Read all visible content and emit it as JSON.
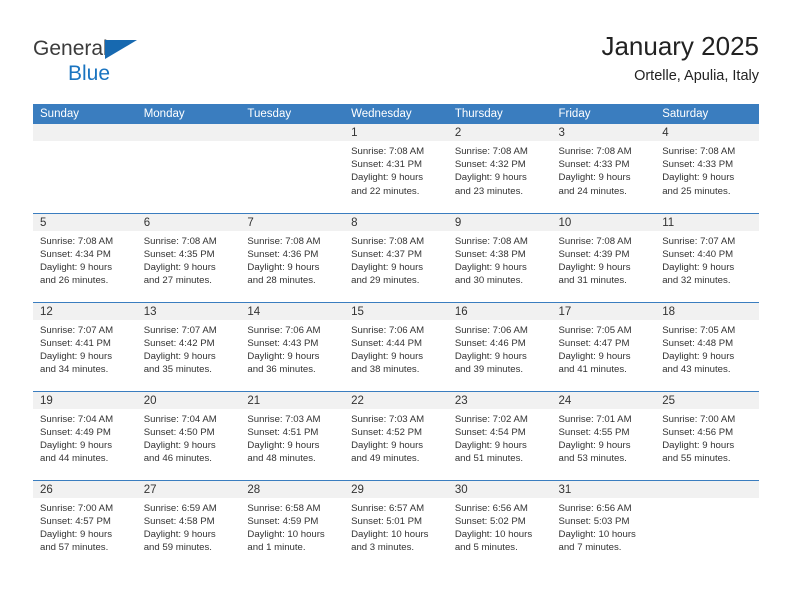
{
  "brand": {
    "line1": "General",
    "line2": "Blue",
    "triangle_icon": "blue-triangle-icon",
    "accent_color": "#1769b0"
  },
  "header": {
    "title": "January 2025",
    "subtitle": "Ortelle, Apulia, Italy"
  },
  "theme": {
    "header_blue": "#3a7dbf",
    "daynum_band": "#f1f1f1",
    "text": "#333333"
  },
  "calendar": {
    "weekday_headers": [
      "Sunday",
      "Monday",
      "Tuesday",
      "Wednesday",
      "Thursday",
      "Friday",
      "Saturday"
    ],
    "labels": {
      "sunrise": "Sunrise:",
      "sunset": "Sunset:",
      "daylight": "Daylight:"
    },
    "weeks": [
      [
        {
          "day": "",
          "empty": true
        },
        {
          "day": "",
          "empty": true
        },
        {
          "day": "",
          "empty": true
        },
        {
          "day": "1",
          "sunrise": "Sunrise: 7:08 AM",
          "sunset": "Sunset: 4:31 PM",
          "daylight_1": "Daylight: 9 hours",
          "daylight_2": "and 22 minutes."
        },
        {
          "day": "2",
          "sunrise": "Sunrise: 7:08 AM",
          "sunset": "Sunset: 4:32 PM",
          "daylight_1": "Daylight: 9 hours",
          "daylight_2": "and 23 minutes."
        },
        {
          "day": "3",
          "sunrise": "Sunrise: 7:08 AM",
          "sunset": "Sunset: 4:33 PM",
          "daylight_1": "Daylight: 9 hours",
          "daylight_2": "and 24 minutes."
        },
        {
          "day": "4",
          "sunrise": "Sunrise: 7:08 AM",
          "sunset": "Sunset: 4:33 PM",
          "daylight_1": "Daylight: 9 hours",
          "daylight_2": "and 25 minutes."
        }
      ],
      [
        {
          "day": "5",
          "sunrise": "Sunrise: 7:08 AM",
          "sunset": "Sunset: 4:34 PM",
          "daylight_1": "Daylight: 9 hours",
          "daylight_2": "and 26 minutes."
        },
        {
          "day": "6",
          "sunrise": "Sunrise: 7:08 AM",
          "sunset": "Sunset: 4:35 PM",
          "daylight_1": "Daylight: 9 hours",
          "daylight_2": "and 27 minutes."
        },
        {
          "day": "7",
          "sunrise": "Sunrise: 7:08 AM",
          "sunset": "Sunset: 4:36 PM",
          "daylight_1": "Daylight: 9 hours",
          "daylight_2": "and 28 minutes."
        },
        {
          "day": "8",
          "sunrise": "Sunrise: 7:08 AM",
          "sunset": "Sunset: 4:37 PM",
          "daylight_1": "Daylight: 9 hours",
          "daylight_2": "and 29 minutes."
        },
        {
          "day": "9",
          "sunrise": "Sunrise: 7:08 AM",
          "sunset": "Sunset: 4:38 PM",
          "daylight_1": "Daylight: 9 hours",
          "daylight_2": "and 30 minutes."
        },
        {
          "day": "10",
          "sunrise": "Sunrise: 7:08 AM",
          "sunset": "Sunset: 4:39 PM",
          "daylight_1": "Daylight: 9 hours",
          "daylight_2": "and 31 minutes."
        },
        {
          "day": "11",
          "sunrise": "Sunrise: 7:07 AM",
          "sunset": "Sunset: 4:40 PM",
          "daylight_1": "Daylight: 9 hours",
          "daylight_2": "and 32 minutes."
        }
      ],
      [
        {
          "day": "12",
          "sunrise": "Sunrise: 7:07 AM",
          "sunset": "Sunset: 4:41 PM",
          "daylight_1": "Daylight: 9 hours",
          "daylight_2": "and 34 minutes."
        },
        {
          "day": "13",
          "sunrise": "Sunrise: 7:07 AM",
          "sunset": "Sunset: 4:42 PM",
          "daylight_1": "Daylight: 9 hours",
          "daylight_2": "and 35 minutes."
        },
        {
          "day": "14",
          "sunrise": "Sunrise: 7:06 AM",
          "sunset": "Sunset: 4:43 PM",
          "daylight_1": "Daylight: 9 hours",
          "daylight_2": "and 36 minutes."
        },
        {
          "day": "15",
          "sunrise": "Sunrise: 7:06 AM",
          "sunset": "Sunset: 4:44 PM",
          "daylight_1": "Daylight: 9 hours",
          "daylight_2": "and 38 minutes."
        },
        {
          "day": "16",
          "sunrise": "Sunrise: 7:06 AM",
          "sunset": "Sunset: 4:46 PM",
          "daylight_1": "Daylight: 9 hours",
          "daylight_2": "and 39 minutes."
        },
        {
          "day": "17",
          "sunrise": "Sunrise: 7:05 AM",
          "sunset": "Sunset: 4:47 PM",
          "daylight_1": "Daylight: 9 hours",
          "daylight_2": "and 41 minutes."
        },
        {
          "day": "18",
          "sunrise": "Sunrise: 7:05 AM",
          "sunset": "Sunset: 4:48 PM",
          "daylight_1": "Daylight: 9 hours",
          "daylight_2": "and 43 minutes."
        }
      ],
      [
        {
          "day": "19",
          "sunrise": "Sunrise: 7:04 AM",
          "sunset": "Sunset: 4:49 PM",
          "daylight_1": "Daylight: 9 hours",
          "daylight_2": "and 44 minutes."
        },
        {
          "day": "20",
          "sunrise": "Sunrise: 7:04 AM",
          "sunset": "Sunset: 4:50 PM",
          "daylight_1": "Daylight: 9 hours",
          "daylight_2": "and 46 minutes."
        },
        {
          "day": "21",
          "sunrise": "Sunrise: 7:03 AM",
          "sunset": "Sunset: 4:51 PM",
          "daylight_1": "Daylight: 9 hours",
          "daylight_2": "and 48 minutes."
        },
        {
          "day": "22",
          "sunrise": "Sunrise: 7:03 AM",
          "sunset": "Sunset: 4:52 PM",
          "daylight_1": "Daylight: 9 hours",
          "daylight_2": "and 49 minutes."
        },
        {
          "day": "23",
          "sunrise": "Sunrise: 7:02 AM",
          "sunset": "Sunset: 4:54 PM",
          "daylight_1": "Daylight: 9 hours",
          "daylight_2": "and 51 minutes."
        },
        {
          "day": "24",
          "sunrise": "Sunrise: 7:01 AM",
          "sunset": "Sunset: 4:55 PM",
          "daylight_1": "Daylight: 9 hours",
          "daylight_2": "and 53 minutes."
        },
        {
          "day": "25",
          "sunrise": "Sunrise: 7:00 AM",
          "sunset": "Sunset: 4:56 PM",
          "daylight_1": "Daylight: 9 hours",
          "daylight_2": "and 55 minutes."
        }
      ],
      [
        {
          "day": "26",
          "sunrise": "Sunrise: 7:00 AM",
          "sunset": "Sunset: 4:57 PM",
          "daylight_1": "Daylight: 9 hours",
          "daylight_2": "and 57 minutes."
        },
        {
          "day": "27",
          "sunrise": "Sunrise: 6:59 AM",
          "sunset": "Sunset: 4:58 PM",
          "daylight_1": "Daylight: 9 hours",
          "daylight_2": "and 59 minutes."
        },
        {
          "day": "28",
          "sunrise": "Sunrise: 6:58 AM",
          "sunset": "Sunset: 4:59 PM",
          "daylight_1": "Daylight: 10 hours",
          "daylight_2": "and 1 minute."
        },
        {
          "day": "29",
          "sunrise": "Sunrise: 6:57 AM",
          "sunset": "Sunset: 5:01 PM",
          "daylight_1": "Daylight: 10 hours",
          "daylight_2": "and 3 minutes."
        },
        {
          "day": "30",
          "sunrise": "Sunrise: 6:56 AM",
          "sunset": "Sunset: 5:02 PM",
          "daylight_1": "Daylight: 10 hours",
          "daylight_2": "and 5 minutes."
        },
        {
          "day": "31",
          "sunrise": "Sunrise: 6:56 AM",
          "sunset": "Sunset: 5:03 PM",
          "daylight_1": "Daylight: 10 hours",
          "daylight_2": "and 7 minutes."
        },
        {
          "day": "",
          "empty": true
        }
      ]
    ]
  }
}
